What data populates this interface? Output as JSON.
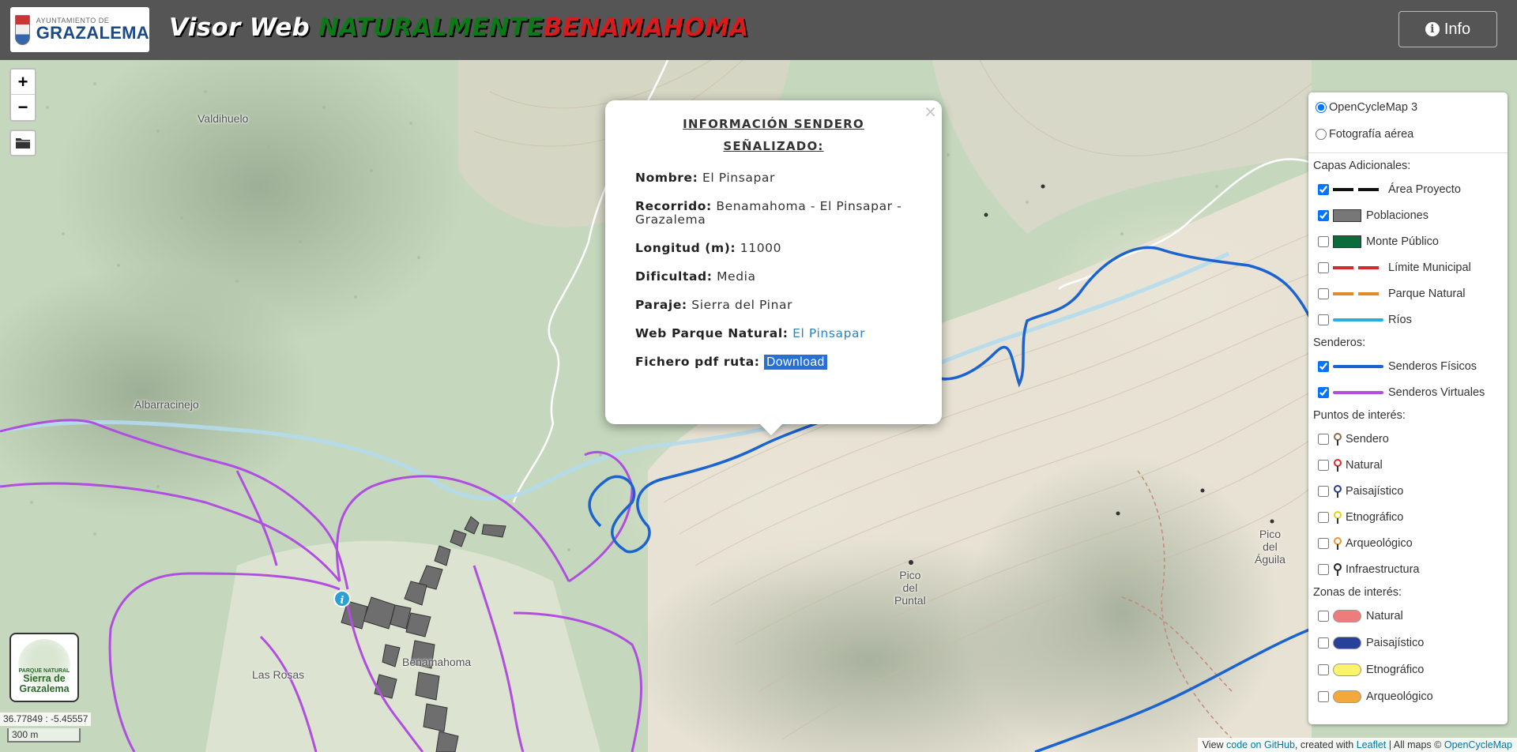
{
  "header": {
    "logo_small": "AYUNTAMIENTO DE",
    "logo_big": "GRAZALEMA",
    "title_part1": "Visor Web",
    "title_part2": "NATURALMENTE",
    "title_part3": "BENAMAHOMA",
    "info_label": "Info"
  },
  "map": {
    "zoom_in": "+",
    "zoom_out": "−",
    "places": {
      "valdihuelo": "Valdihuelo",
      "albarracinejo": "Albarracinejo",
      "las_rosas": "Las Rosas",
      "benamahoma": "Benamahoma",
      "pico_puntal": [
        "Pico",
        "del",
        "Puntal"
      ],
      "pico_aguila": [
        "Pico",
        "del",
        "Águila"
      ]
    },
    "coordinates": "36.77849 : -5.45557",
    "scale": "300 m"
  },
  "popup": {
    "close": "×",
    "title_line1": "INFORMACIÓN SENDERO",
    "title_line2": "SEÑALIZADO:",
    "fields": [
      {
        "label": "Nombre:",
        "value": "El Pinsapar"
      },
      {
        "label": "Recorrido:",
        "value": "Benamahoma - El Pinsapar - Grazalema"
      },
      {
        "label": "Longitud (m):",
        "value": "11000"
      },
      {
        "label": "Dificultad:",
        "value": "Media"
      },
      {
        "label": "Paraje:",
        "value": "Sierra del Pinar"
      }
    ],
    "web_label": "Web Parque Natural:",
    "web_link": "El Pinsapar",
    "pdf_label": "Fichero pdf ruta:",
    "pdf_link": "Download"
  },
  "layers": {
    "base": [
      {
        "label": "OpenCycleMap 3",
        "checked": true
      },
      {
        "label": "Fotografía aérea",
        "checked": false
      }
    ],
    "additional_header": "Capas Adicionales:",
    "additional": [
      {
        "label": "Área Proyecto",
        "checked": true,
        "color": "#111111"
      },
      {
        "label": "Poblaciones",
        "checked": true,
        "color": "#777777"
      },
      {
        "label": "Monte Público",
        "checked": false,
        "color": "#0b6b3a"
      },
      {
        "label": "Límite Municipal",
        "checked": false,
        "color": "#d02a2a"
      },
      {
        "label": "Parque Natural",
        "checked": false,
        "color": "#e08a2a"
      },
      {
        "label": "Ríos",
        "checked": false,
        "color": "#2aaee0"
      }
    ],
    "trails_header": "Senderos:",
    "trails": [
      {
        "label": "Senderos Físicos",
        "checked": true,
        "color": "#1a63d1"
      },
      {
        "label": "Senderos Virtuales",
        "checked": true,
        "color": "#b04ee0"
      }
    ],
    "poi_header": "Puntos de interés:",
    "poi": [
      {
        "label": "Sendero",
        "checked": false,
        "color": "#8a6a4a"
      },
      {
        "label": "Natural",
        "checked": false,
        "color": "#e02a2a"
      },
      {
        "label": "Paisajístico",
        "checked": false,
        "color": "#2a3a8a"
      },
      {
        "label": "Etnográfico",
        "checked": false,
        "color": "#e6d21a"
      },
      {
        "label": "Arqueológico",
        "checked": false,
        "color": "#e89a2a"
      },
      {
        "label": "Infraestructura",
        "checked": false,
        "color": "#222222"
      }
    ],
    "zones_header": "Zonas de interés:",
    "zones": [
      {
        "label": "Natural",
        "checked": false,
        "color": "#ee7c7c"
      },
      {
        "label": "Paisajístico",
        "checked": false,
        "color": "#27409a"
      },
      {
        "label": "Etnográfico",
        "checked": false,
        "color": "#fbf36a"
      },
      {
        "label": "Arqueológico",
        "checked": false,
        "color": "#f2a83a"
      }
    ]
  },
  "np_logo": {
    "small": "PARQUE NATURAL",
    "line1": "Sierra de",
    "line2": "Grazalema"
  },
  "attribution": {
    "view": "View ",
    "code_link": "code on GitHub",
    "created": ", created with ",
    "leaflet_link": "Leaflet",
    "maps": " | All maps © ",
    "ocm_link": "OpenCycleMap"
  }
}
